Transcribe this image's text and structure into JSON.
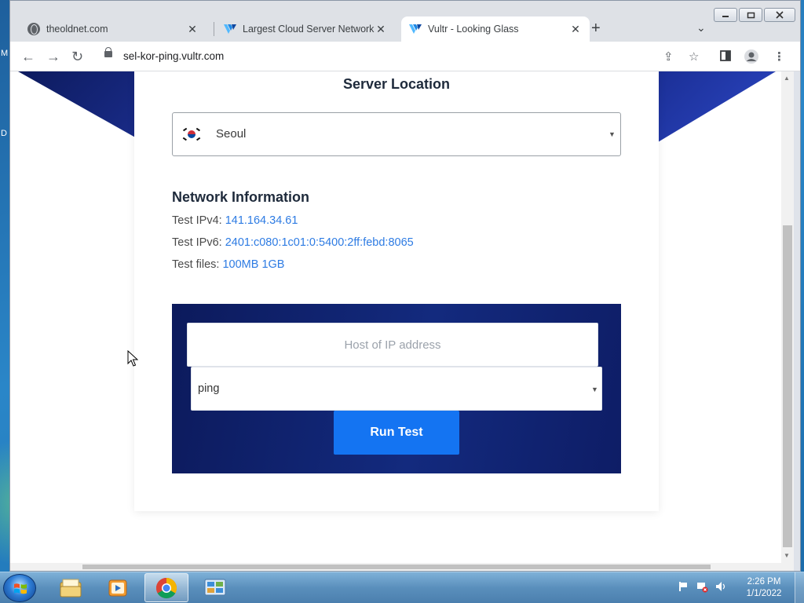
{
  "browser": {
    "tabs": [
      {
        "title": "theoldnet.com",
        "favicon": "globe-icon"
      },
      {
        "title": "Largest Cloud Server Network Av",
        "favicon": "vultr-logo-icon"
      },
      {
        "title": "Vultr - Looking Glass",
        "favicon": "vultr-logo-icon",
        "active": true
      }
    ],
    "new_tab": "+",
    "url": "sel-kor-ping.vultr.com"
  },
  "page": {
    "server_location_title": "Server Location",
    "location": "Seoul",
    "network_title": "Network Information",
    "ipv4_label": "Test IPv4:",
    "ipv4_value": "141.164.34.61",
    "ipv6_label": "Test IPv6:",
    "ipv6_value": "2401:c080:1c01:0:5400:2ff:febd:8065",
    "files_label": "Test files:",
    "files_value": "100MB 1GB",
    "host_placeholder": "Host of IP address",
    "method": "ping",
    "run_button": "Run Test"
  },
  "taskbar": {
    "apps": [
      "explorer-icon",
      "media-player-icon",
      "chrome-icon",
      "control-panel-icon"
    ],
    "time": "2:26 PM",
    "date": "1/1/2022"
  },
  "desktop_letters": [
    "M",
    "D"
  ],
  "colors": {
    "accent_blue": "#1474f2",
    "link_blue": "#2d7be3",
    "panel_navy": "#0c1a5c"
  }
}
